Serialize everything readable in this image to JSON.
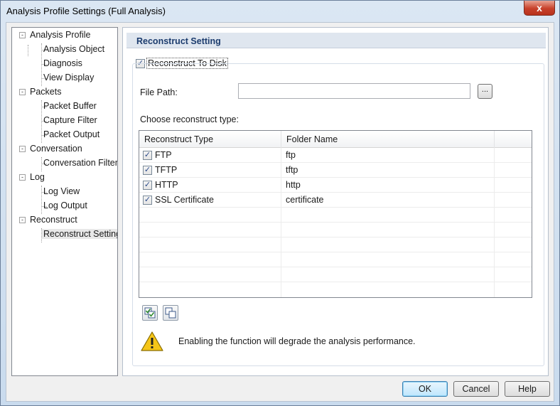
{
  "window": {
    "title": "Analysis Profile Settings (Full Analysis)",
    "close_glyph": "x"
  },
  "tree": {
    "items": [
      {
        "label": "Analysis Profile",
        "level": 0,
        "expander": "-"
      },
      {
        "label": "Analysis Object",
        "level": 1
      },
      {
        "label": "Diagnosis",
        "level": 1
      },
      {
        "label": "View Display",
        "level": 1
      },
      {
        "label": "Packets",
        "level": 0,
        "expander": "-"
      },
      {
        "label": "Packet Buffer",
        "level": 1
      },
      {
        "label": "Capture Filter",
        "level": 1
      },
      {
        "label": "Packet Output",
        "level": 1
      },
      {
        "label": "Conversation",
        "level": 0,
        "expander": "-"
      },
      {
        "label": "Conversation Filter",
        "level": 1
      },
      {
        "label": "Log",
        "level": 0,
        "expander": "-"
      },
      {
        "label": "Log View",
        "level": 1
      },
      {
        "label": "Log Output",
        "level": 1
      },
      {
        "label": "Reconstruct",
        "level": 0,
        "expander": "-"
      },
      {
        "label": "Reconstruct Setting",
        "level": 1,
        "selected": true
      }
    ]
  },
  "panel": {
    "header": "Reconstruct Setting",
    "reconstruct_to_disk": {
      "label": "Reconstruct To Disk",
      "checked": true
    },
    "file_path": {
      "label": "File Path:",
      "value": "",
      "browse_label": "..."
    },
    "choose_label": "Choose reconstruct type:",
    "grid": {
      "columns": [
        "Reconstruct Type",
        "Folder Name"
      ],
      "rows": [
        {
          "type": "FTP",
          "folder": "ftp",
          "checked": true
        },
        {
          "type": "TFTP",
          "folder": "tftp",
          "checked": true
        },
        {
          "type": "HTTP",
          "folder": "http",
          "checked": true
        },
        {
          "type": "SSL Certificate",
          "folder": "certificate",
          "checked": true
        }
      ],
      "empty_rows": 6
    },
    "toolbar": {
      "select_all_icon": "check-all-icon",
      "deselect_icon": "uncheck-all-icon"
    },
    "warning": {
      "icon": "warning-icon",
      "text": "Enabling the function will degrade the analysis performance."
    }
  },
  "buttons": {
    "ok": "OK",
    "cancel": "Cancel",
    "help": "Help"
  },
  "colors": {
    "header_text": "#1c3c6e",
    "close_red": "#c7412a",
    "check": "#2b4a8a"
  }
}
